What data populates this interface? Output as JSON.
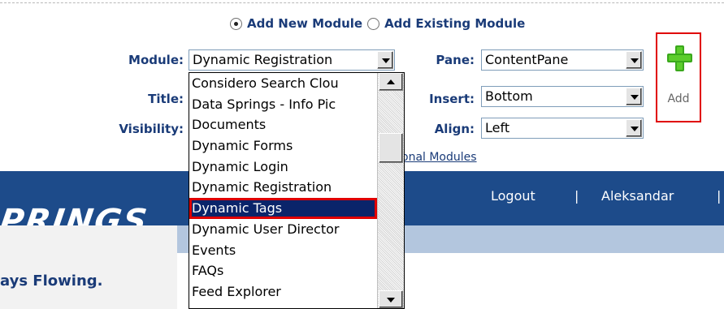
{
  "radio_options": [
    {
      "label": "Add New Module",
      "checked": true
    },
    {
      "label": "Add Existing Module",
      "checked": false
    }
  ],
  "fields": {
    "module": {
      "label": "Module:",
      "value": "Dynamic Registration"
    },
    "title": {
      "label": "Title:"
    },
    "visibility": {
      "label": "Visibility:"
    },
    "pane": {
      "label": "Pane:",
      "value": "ContentPane"
    },
    "insert": {
      "label": "Insert:",
      "value": "Bottom"
    },
    "align": {
      "label": "Align:",
      "value": "Left"
    }
  },
  "add_button": {
    "label": "Add",
    "icon": "plus-icon"
  },
  "additional_modules_link": "onal Modules",
  "module_dropdown": {
    "items": [
      "Considero Search Clou",
      "Data Springs - Info Pic",
      "Documents",
      "Dynamic Forms",
      "Dynamic Login",
      "Dynamic Registration",
      "Dynamic Tags",
      "Dynamic User Director",
      "Events",
      "FAQs",
      "Feed Explorer"
    ],
    "highlighted": "Dynamic Tags"
  },
  "site_header": {
    "logo_text": "PRINGS",
    "tagline": "ays Flowing.",
    "nav": [
      "Logout",
      "Aleksandar"
    ],
    "separator": "|"
  },
  "colors": {
    "label_blue": "#1a3b78",
    "header_blue": "#1d4b8a",
    "highlight_red": "#e00000",
    "selection_navy": "#0a246a",
    "plus_green": "#3aa81c"
  }
}
